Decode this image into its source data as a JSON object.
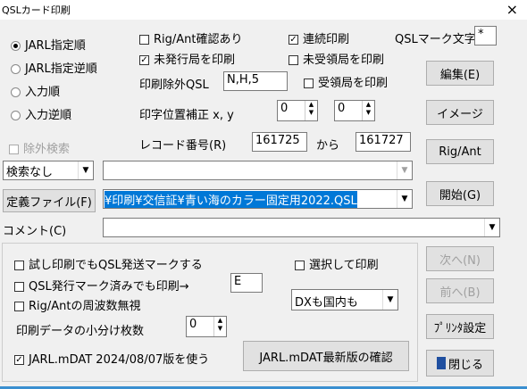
{
  "window": {
    "title": "QSLカード印刷",
    "close": "×"
  },
  "order_radios": [
    {
      "label": "JARL指定順",
      "checked": true
    },
    {
      "label": "JARL指定逆順",
      "checked": false
    },
    {
      "label": "入力順",
      "checked": false
    },
    {
      "label": "入力逆順",
      "checked": false
    }
  ],
  "opts": {
    "rig_ant": {
      "label": "Rig/Ant確認あり",
      "checked": false
    },
    "continuous": {
      "label": "連続印刷",
      "checked": true
    },
    "unissued": {
      "label": "未発行局を印刷",
      "checked": true
    },
    "unreceived": {
      "label": "未受領局を印刷",
      "checked": false
    },
    "received": {
      "label": "受領局を印刷",
      "checked": false
    }
  },
  "qsl_mark": {
    "label": "QSLマーク文字",
    "value": "*"
  },
  "exclude_qsl": {
    "label": "印刷除外QSL",
    "value": "N,H,5"
  },
  "position": {
    "label": "印字位置補正 x, y",
    "x": "0",
    "y": "0"
  },
  "exclude_search": {
    "label": "除外検索"
  },
  "record": {
    "label": "レコード番号(R)",
    "from_value": "161725",
    "to_label": "から",
    "to_value": "161727"
  },
  "search_combo": {
    "value": "検索なし"
  },
  "def_file": {
    "button": "定義ファイル(F)",
    "value": "¥印刷¥交信証¥青い海のカラー固定用2022.QSL"
  },
  "comment": {
    "label": "コメント(C)",
    "value": ""
  },
  "test_print": {
    "label": "試し印刷でもQSL発送マークする",
    "checked": false
  },
  "select_print": {
    "label": "選択して印刷",
    "checked": false
  },
  "issued_mark": {
    "label": "QSL発行マーク済みでも印刷→",
    "value": "E",
    "checked": false
  },
  "ignore_freq": {
    "label": "Rig/Antの周波数無視",
    "checked": false
  },
  "dx_combo": {
    "value": "DXも国内も"
  },
  "split": {
    "label": "印刷データの小分け枚数",
    "value": "0"
  },
  "jarl_mdat": {
    "label": "JARL.mDAT 2024/08/07版を使う",
    "checked": true,
    "check_button": "JARL.mDAT最新版の確認"
  },
  "buttons": {
    "edit": "編集(E)",
    "image": "イメージ",
    "rigant": "Rig/Ant",
    "start": "開始(G)",
    "next": "次へ(N)",
    "prev": "前へ(B)",
    "printer": "ﾌﾟﾘﾝﾀ設定",
    "close": "閉じる"
  }
}
